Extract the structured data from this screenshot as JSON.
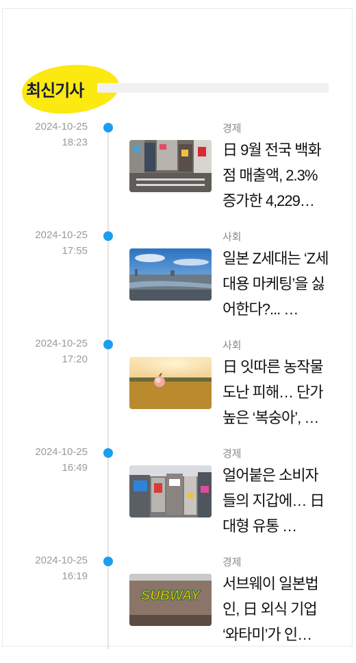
{
  "section": {
    "title": "최신기사"
  },
  "articles": [
    {
      "date": "2024-10-25",
      "time": "18:23",
      "category": "경제",
      "headline": "日 9월 전국 백화점 매출액, 2.3% 증가한 4,229…",
      "image": "shibuya-crossing"
    },
    {
      "date": "2024-10-25",
      "time": "17:55",
      "category": "사회",
      "headline": "일본 Z세대는 ‘Z세대용 마케팅’을 싫어한다?... …",
      "image": "city-skyline-river"
    },
    {
      "date": "2024-10-25",
      "time": "17:20",
      "category": "사회",
      "headline": "日 잇따른 농작물 도난 피해… 단가 높은 ‘복숭아’, …",
      "image": "peach-on-grass"
    },
    {
      "date": "2024-10-25",
      "time": "16:49",
      "category": "경제",
      "headline": "얼어붙은 소비자들의 지갑에… 日 대형 유통 …",
      "image": "shibuya-signs"
    },
    {
      "date": "2024-10-25",
      "time": "16:19",
      "category": "경제",
      "headline": "서브웨이 일본법인, 日 외식 기업 ‘와타미’가 인…",
      "image": "subway-storefront"
    }
  ],
  "thumbs": {
    "subway_logo": "SUBWAY"
  },
  "colors": {
    "accent": "#1a9ef0",
    "highlight": "#fbe910",
    "title": "#1a1c3b"
  }
}
